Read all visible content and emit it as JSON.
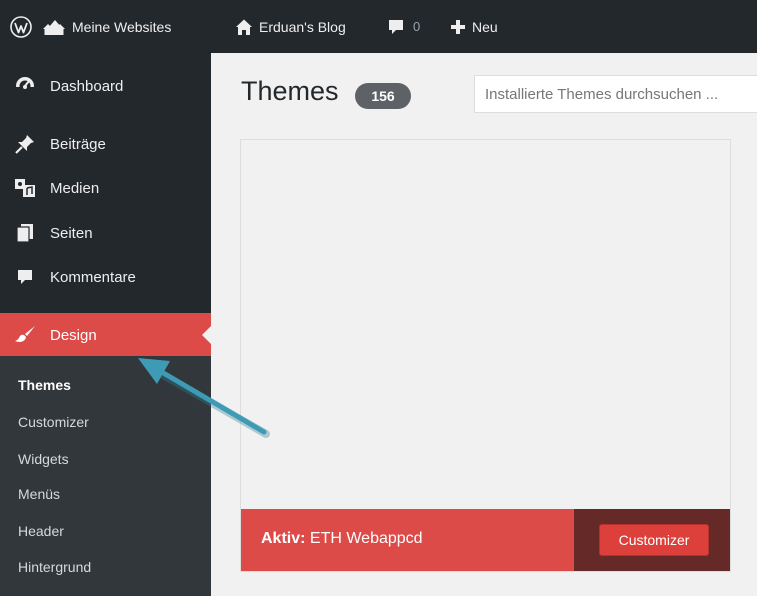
{
  "adminbar": {
    "my_sites": "Meine Websites",
    "site_name": "Erduan's Blog",
    "comments_count": "0",
    "new_label": "Neu"
  },
  "sidebar": {
    "items": [
      {
        "label": "Dashboard",
        "icon": "dashboard-icon"
      },
      {
        "label": "Beiträge",
        "icon": "pushpin-icon"
      },
      {
        "label": "Medien",
        "icon": "media-icon"
      },
      {
        "label": "Seiten",
        "icon": "pages-icon"
      },
      {
        "label": "Kommentare",
        "icon": "comment-icon"
      },
      {
        "label": "Design",
        "icon": "paintbrush-icon",
        "active": true
      }
    ],
    "submenu": [
      "Themes",
      "Customizer",
      "Widgets",
      "Menüs",
      "Header",
      "Hintergrund"
    ]
  },
  "main": {
    "title": "Themes",
    "count": "156",
    "search_placeholder": "Installierte Themes durchsuchen ...",
    "active_theme": {
      "prefix": "Aktiv:",
      "name": "ETH Webappcd",
      "button": "Customizer"
    }
  },
  "colors": {
    "adminbar_bg": "#23282d",
    "accent": "#dd4b49",
    "submenu_bg": "#32373c",
    "arrow": "#3d9bb6"
  }
}
